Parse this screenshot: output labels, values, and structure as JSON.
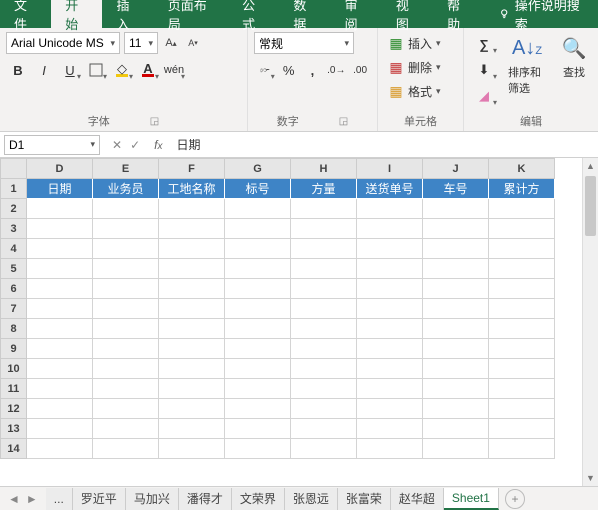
{
  "ribbon": {
    "tabs": [
      "文件",
      "开始",
      "插入",
      "页面布局",
      "公式",
      "数据",
      "审阅",
      "视图",
      "帮助"
    ],
    "activeIndex": 1,
    "search": "操作说明搜索"
  },
  "font": {
    "name": "Arial Unicode MS",
    "size": "11",
    "groupLabel": "字体"
  },
  "number": {
    "format": "常规",
    "groupLabel": "数字"
  },
  "cells": {
    "insert": "插入",
    "delete": "删除",
    "format": "格式",
    "groupLabel": "单元格"
  },
  "editing": {
    "sortFilter": "排序和筛选",
    "find": "查找",
    "groupLabel": "编辑"
  },
  "nameBox": "D1",
  "formulaValue": "日期",
  "columns": [
    "D",
    "E",
    "F",
    "G",
    "H",
    "I",
    "J",
    "K"
  ],
  "headerRow": [
    "日期",
    "业务员",
    "工地名称",
    "标号",
    "方量",
    "送货单号",
    "车号",
    "累计方"
  ],
  "rowCount": 14,
  "sheetTabs": {
    "ellipsis": "...",
    "tabs": [
      "罗近平",
      "马加兴",
      "潘得才",
      "文荣界",
      "张恩远",
      "张富荣",
      "赵华超",
      "Sheet1"
    ],
    "activeIndex": 7
  }
}
